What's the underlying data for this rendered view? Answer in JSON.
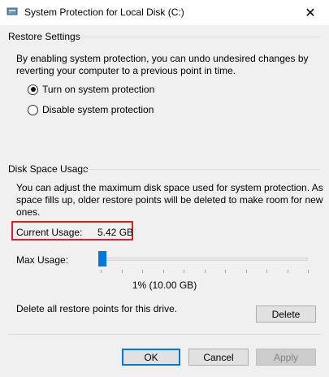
{
  "window": {
    "title": "System Protection for Local Disk (C:)",
    "close_glyph": "✕"
  },
  "restore_settings": {
    "heading": "Restore Settings",
    "description_line1": "By enabling system protection, you can undo undesired changes by",
    "description_line2": "reverting your computer to a previous point in time.",
    "options": [
      {
        "label": "Turn on system protection",
        "selected": true
      },
      {
        "label": "Disable system protection",
        "selected": false
      }
    ]
  },
  "disk_space": {
    "heading": "Disk Space Usage",
    "description_line1": "You can adjust the maximum disk space used for system protection. As",
    "description_line2": "space fills up, older restore points will be deleted to make room for new",
    "description_line3": "ones.",
    "current_usage_label": "Current Usage:",
    "current_usage_value": "5.42 GB",
    "max_usage_label": "Max Usage:",
    "max_usage_fraction": 0.01,
    "max_usage_caption": "1% (10.00 GB)",
    "delete_text": "Delete all restore points for this drive.",
    "delete_button": "Delete"
  },
  "buttons": {
    "ok": "OK",
    "cancel": "Cancel",
    "apply": "Apply"
  },
  "colors": {
    "accent": "#0078d7",
    "highlight_box": "#e0201f"
  },
  "icons": {
    "title": "drive-protection-icon",
    "close": "close-icon"
  }
}
